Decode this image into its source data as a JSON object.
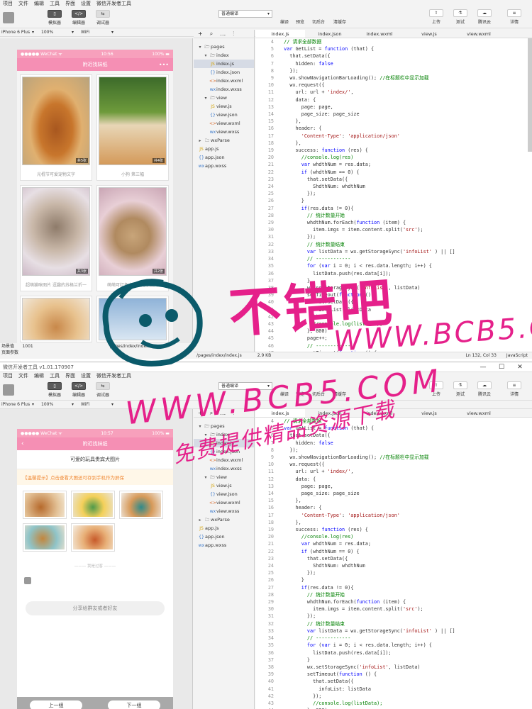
{
  "window2_title": "微信开发者工具 v1.01.170907",
  "menu": [
    "项目",
    "文件",
    "编辑",
    "工具",
    "界面",
    "设置",
    "微信开发者工具"
  ],
  "toolbar": {
    "simulator": "模拟器",
    "editor": "编辑器",
    "debugger": "调试器",
    "mode": "普通编译",
    "compile": "编译",
    "preview": "预览",
    "backstage": "切后台",
    "clear_cache": "清缓存",
    "upload": "上传",
    "test": "测试",
    "tencent_cloud": "腾讯云",
    "details": "详情"
  },
  "device": {
    "model1": "iPhone 6 Plus",
    "model2": "iPhone 6 Plus",
    "zoom": "100%",
    "network": "WiFi"
  },
  "phone1": {
    "carrier": "●●●●● WeChat ᯤ",
    "time": "10:56",
    "battery": "100% ▬",
    "title": "附近找妹纸",
    "cards": [
      {
        "count": "共5张",
        "caption": "光棍节可爱宠物文字"
      },
      {
        "count": "共4张",
        "caption": "小狗 第三幅"
      },
      {
        "count": "共3张",
        "caption": "超萌猫咪图片 逗趣的苏格兰折一"
      },
      {
        "count": "共2张",
        "caption": "萌萌可红免大力小兔子图片"
      }
    ]
  },
  "sim1_footer": {
    "scene_label": "场景值",
    "scene_value": "1001",
    "page_path": "pages/index/index",
    "page_params": "页面参数"
  },
  "tree": {
    "pages": "pages",
    "index": "index",
    "files_index": [
      "index.js",
      "index.json",
      "index.wxml",
      "index.wxss"
    ],
    "view": "view",
    "files_view": [
      "view.js",
      "view.json",
      "view.wxml",
      "view.wxss"
    ],
    "wxParse": "wxParse",
    "files_root": [
      "app.js",
      "app.json",
      "app.wxss"
    ]
  },
  "tabs": [
    "index.js",
    "index.json",
    "index.wxml",
    "view.js",
    "view.wxml"
  ],
  "status1": {
    "path": "/pages/index/index.js",
    "size": "2.9 KB",
    "pos": "Ln 132, Col 33",
    "lang": "JavaScript"
  },
  "phone2": {
    "carrier": "●●●●● WeChat ᯤ",
    "time": "10:57",
    "battery": "100% ▬",
    "title": "附近找妹纸",
    "heading": "可爱的玩具贵宾犬图片",
    "tip": "【温馨提示】点击查看大图还可存到手机作为屏保",
    "divider": "——— 我是过客 ———",
    "share": "分享给群友或者好友",
    "prev": "上一组",
    "next": "下一组"
  },
  "watermark": {
    "cn": "不错吧",
    "url": "WWW.BCB5.COM",
    "url2": "WWW.BCB5.COM",
    "sub": "免费提供精品资源下载"
  },
  "code1": [
    [
      "4",
      [
        [
          "cm",
          "  // 请求全部数据"
        ]
      ]
    ],
    [
      "5",
      [
        [
          "kw",
          "  var "
        ],
        [
          "",
          "GetList = "
        ],
        [
          "kw",
          "function"
        ],
        [
          "",
          " (that) {"
        ]
      ]
    ],
    [
      "6",
      [
        [
          "",
          "    that.setData({"
        ]
      ]
    ],
    [
      "7",
      [
        [
          "",
          "      hidden: "
        ],
        [
          "kw",
          "false"
        ]
      ]
    ],
    [
      "8",
      [
        [
          "",
          "    });"
        ]
      ]
    ],
    [
      "9",
      [
        [
          "",
          "    wx.showNavigationBarLoading(); "
        ],
        [
          "cm",
          "//在标题栏中显示加载"
        ]
      ]
    ],
    [
      "10",
      [
        [
          "",
          "    wx.request({"
        ]
      ]
    ],
    [
      "11",
      [
        [
          "",
          "      url: url + "
        ],
        [
          "str",
          "'index/'"
        ],
        [
          "",
          ","
        ]
      ]
    ],
    [
      "12",
      [
        [
          "",
          "      data: {"
        ]
      ]
    ],
    [
      "13",
      [
        [
          "",
          "        page: page,"
        ]
      ]
    ],
    [
      "14",
      [
        [
          "",
          "        page_size: page_size"
        ]
      ]
    ],
    [
      "15",
      [
        [
          "",
          "      },"
        ]
      ]
    ],
    [
      "16",
      [
        [
          "",
          "      header: {"
        ]
      ]
    ],
    [
      "17",
      [
        [
          "str",
          "        'Content-Type'"
        ],
        [
          "",
          ": "
        ],
        [
          "str",
          "'application/json'"
        ]
      ]
    ],
    [
      "18",
      [
        [
          "",
          "      },"
        ]
      ]
    ],
    [
      "19",
      [
        [
          "",
          "      success: "
        ],
        [
          "kw",
          "function"
        ],
        [
          "",
          " (res) {"
        ]
      ]
    ],
    [
      "20",
      [
        [
          "cm",
          "        //console.log(res)"
        ]
      ]
    ],
    [
      "21",
      [
        [
          "kw",
          "        var"
        ],
        [
          "",
          " whdthNum = res.data;"
        ]
      ]
    ],
    [
      "22",
      [
        [
          "kw",
          "        if"
        ],
        [
          "",
          " (whdthNum == 0) {"
        ]
      ]
    ],
    [
      "23",
      [
        [
          "",
          "          that.setData({"
        ]
      ]
    ],
    [
      "24",
      [
        [
          "",
          "            ShdthNum: whdthNum"
        ]
      ]
    ],
    [
      "25",
      [
        [
          "",
          "          });"
        ]
      ]
    ],
    [
      "26",
      [
        [
          "",
          "        }"
        ]
      ]
    ],
    [
      "27",
      [
        [
          "kw",
          "        if"
        ],
        [
          "",
          "(res.data != 0){"
        ]
      ]
    ],
    [
      "28",
      [
        [
          "cm",
          "          // 统计数量开始"
        ]
      ]
    ],
    [
      "29",
      [
        [
          "",
          "          whdthNum.forEach("
        ],
        [
          "kw",
          "function"
        ],
        [
          "",
          " (item) {"
        ]
      ]
    ],
    [
      "30",
      [
        [
          "",
          "            item.imgs = item.content.split("
        ],
        [
          "str",
          "'src'"
        ],
        [
          "",
          ");"
        ]
      ]
    ],
    [
      "31",
      [
        [
          "",
          "          });"
        ]
      ]
    ],
    [
      "32",
      [
        [
          "cm",
          "          // 统计数量结束"
        ]
      ]
    ],
    [
      "33",
      [
        [
          "kw",
          "          var"
        ],
        [
          "",
          " listData = wx.getStorageSync("
        ],
        [
          "str",
          "'infoList'"
        ],
        [
          "",
          " ) || []"
        ]
      ]
    ],
    [
      "34",
      [
        [
          "cm",
          "          // ------------"
        ]
      ]
    ],
    [
      "35",
      [
        [
          "kw",
          "          for"
        ],
        [
          "",
          " ("
        ],
        [
          "kw",
          "var"
        ],
        [
          "",
          " i = 0; i < res.data.length; i++) {"
        ]
      ]
    ],
    [
      "36",
      [
        [
          "",
          "            listData.push(res.data[i]);"
        ]
      ]
    ],
    [
      "37",
      [
        [
          "",
          "          }"
        ]
      ]
    ],
    [
      "38",
      [
        [
          "",
          "          wx.setStorageSync("
        ],
        [
          "str",
          "'infoList'"
        ],
        [
          "",
          ", listData)"
        ]
      ]
    ],
    [
      "39",
      [
        [
          "",
          "          setTimeout("
        ],
        [
          "kw",
          "function"
        ],
        [
          "",
          " () {"
        ]
      ]
    ],
    [
      "40",
      [
        [
          "",
          "            that.setData({"
        ]
      ]
    ],
    [
      "41",
      [
        [
          "",
          "              infoList: listData"
        ]
      ]
    ],
    [
      "42",
      [
        [
          "",
          "            });"
        ]
      ]
    ],
    [
      "43",
      [
        [
          "cm",
          "            //console.log(listData);"
        ]
      ]
    ],
    [
      "44",
      [
        [
          "",
          "          }, 800)"
        ]
      ]
    ],
    [
      "45",
      [
        [
          "",
          "          page++;"
        ]
      ]
    ],
    [
      "46",
      [
        [
          "cm",
          "          // ------------"
        ]
      ]
    ],
    [
      "47",
      [
        [
          "",
          "          setTimeout("
        ],
        [
          "kw",
          "function"
        ],
        [
          "",
          " () {"
        ]
      ]
    ],
    [
      "48",
      [
        [
          "",
          "            that.setData({"
        ]
      ]
    ]
  ],
  "code2": [
    [
      "4",
      [
        [
          "cm",
          "  // 请求全部数据"
        ]
      ]
    ],
    [
      "5",
      [
        [
          "kw",
          "  var "
        ],
        [
          "",
          "GetList = "
        ],
        [
          "kw",
          "function"
        ],
        [
          "",
          " (that) {"
        ]
      ]
    ],
    [
      "6",
      [
        [
          "",
          "    that.setData({"
        ]
      ]
    ],
    [
      "7",
      [
        [
          "",
          "      hidden: "
        ],
        [
          "kw",
          "false"
        ]
      ]
    ],
    [
      "8",
      [
        [
          "",
          "    });"
        ]
      ]
    ],
    [
      "9",
      [
        [
          "",
          "    wx.showNavigationBarLoading(); "
        ],
        [
          "cm",
          "//在标题栏中显示加载"
        ]
      ]
    ],
    [
      "10",
      [
        [
          "",
          "    wx.request({"
        ]
      ]
    ],
    [
      "11",
      [
        [
          "",
          "      url: url + "
        ],
        [
          "str",
          "'index/'"
        ],
        [
          "",
          ","
        ]
      ]
    ],
    [
      "12",
      [
        [
          "",
          "      data: {"
        ]
      ]
    ],
    [
      "13",
      [
        [
          "",
          "        page: page,"
        ]
      ]
    ],
    [
      "14",
      [
        [
          "",
          "        page_size: page_size"
        ]
      ]
    ],
    [
      "15",
      [
        [
          "",
          "      },"
        ]
      ]
    ],
    [
      "16",
      [
        [
          "",
          "      header: {"
        ]
      ]
    ],
    [
      "17",
      [
        [
          "str",
          "        'Content-Type'"
        ],
        [
          "",
          ": "
        ],
        [
          "str",
          "'application/json'"
        ]
      ]
    ],
    [
      "18",
      [
        [
          "",
          "      },"
        ]
      ]
    ],
    [
      "19",
      [
        [
          "",
          "      success: "
        ],
        [
          "kw",
          "function"
        ],
        [
          "",
          " (res) {"
        ]
      ]
    ],
    [
      "20",
      [
        [
          "cm",
          "        //console.log(res)"
        ]
      ]
    ],
    [
      "21",
      [
        [
          "kw",
          "        var"
        ],
        [
          "",
          " whdthNum = res.data;"
        ]
      ]
    ],
    [
      "22",
      [
        [
          "kw",
          "        if"
        ],
        [
          "",
          " (whdthNum == 0) {"
        ]
      ]
    ],
    [
      "23",
      [
        [
          "",
          "          that.setData({"
        ]
      ]
    ],
    [
      "24",
      [
        [
          "",
          "            ShdthNum: whdthNum"
        ]
      ]
    ],
    [
      "25",
      [
        [
          "",
          "          });"
        ]
      ]
    ],
    [
      "26",
      [
        [
          "",
          "        }"
        ]
      ]
    ],
    [
      "27",
      [
        [
          "kw",
          "        if"
        ],
        [
          "",
          "(res.data != 0){"
        ]
      ]
    ],
    [
      "28",
      [
        [
          "cm",
          "          // 统计数量开始"
        ]
      ]
    ],
    [
      "29",
      [
        [
          "",
          "          whdthNum.forEach("
        ],
        [
          "kw",
          "function"
        ],
        [
          "",
          " (item) {"
        ]
      ]
    ],
    [
      "30",
      [
        [
          "",
          "            item.imgs = item.content.split("
        ],
        [
          "str",
          "'src'"
        ],
        [
          "",
          ");"
        ]
      ]
    ],
    [
      "31",
      [
        [
          "",
          "          });"
        ]
      ]
    ],
    [
      "32",
      [
        [
          "cm",
          "          // 统计数量结束"
        ]
      ]
    ],
    [
      "33",
      [
        [
          "kw",
          "          var"
        ],
        [
          "",
          " listData = wx.getStorageSync("
        ],
        [
          "str",
          "'infoList'"
        ],
        [
          "",
          " ) || []"
        ]
      ]
    ],
    [
      "34",
      [
        [
          "cm",
          "          // ------------"
        ]
      ]
    ],
    [
      "35",
      [
        [
          "kw",
          "          for"
        ],
        [
          "",
          " ("
        ],
        [
          "kw",
          "var"
        ],
        [
          "",
          " i = 0; i < res.data.length; i++) {"
        ]
      ]
    ],
    [
      "36",
      [
        [
          "",
          "            listData.push(res.data[i]);"
        ]
      ]
    ],
    [
      "37",
      [
        [
          "",
          "          }"
        ]
      ]
    ],
    [
      "38",
      [
        [
          "",
          "          wx.setStorageSync("
        ],
        [
          "str",
          "'infoList'"
        ],
        [
          "",
          ", listData)"
        ]
      ]
    ],
    [
      "39",
      [
        [
          "",
          "          setTimeout("
        ],
        [
          "kw",
          "function"
        ],
        [
          "",
          " () {"
        ]
      ]
    ],
    [
      "40",
      [
        [
          "",
          "            that.setData({"
        ]
      ]
    ],
    [
      "41",
      [
        [
          "",
          "              infoList: listData"
        ]
      ]
    ],
    [
      "42",
      [
        [
          "",
          "            });"
        ]
      ]
    ],
    [
      "43",
      [
        [
          "cm",
          "            //console.log(listData);"
        ]
      ]
    ],
    [
      "44",
      [
        [
          "",
          "          }, 800)"
        ]
      ]
    ],
    [
      "45",
      [
        [
          "",
          "          page++;"
        ]
      ]
    ],
    [
      "46",
      [
        [
          "cm",
          "          //"
        ]
      ]
    ]
  ]
}
